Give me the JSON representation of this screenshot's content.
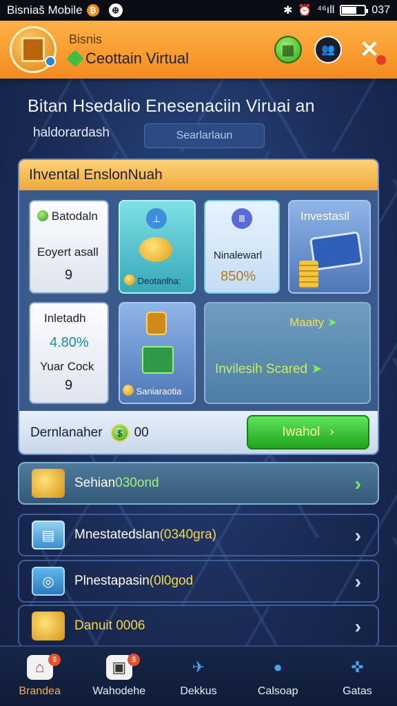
{
  "status_bar": {
    "app_name": "Bisniaš Mobile",
    "time": "037",
    "signal": "⁴⁶ıll"
  },
  "header": {
    "brand_top": "Bisnis",
    "brand_name": "Ceottain Virtual"
  },
  "page": {
    "title": "Bitan Hsedalio Enesenaciin Viruai an",
    "subtitle": "haldorardash",
    "search_placeholder": "Searlarlaun"
  },
  "panel": {
    "title": "Ihvental EnslonNuah",
    "cards": {
      "c1": {
        "title": "Batodaln",
        "label": "Eoyert asall",
        "value": "9"
      },
      "c2": {
        "badge": "Deotanlha:"
      },
      "c3": {
        "label": "Ninalewarl",
        "value": "850%"
      },
      "c4": {
        "title": "Investasil"
      },
      "c5": {
        "title": "Inletadh",
        "value": "4.80%",
        "label": "Yuar Cock",
        "value2": "9"
      },
      "c6": {
        "badge": "Saniaraotia"
      },
      "c7": {
        "line1": "Maaity",
        "line2": "Invilesih Scared"
      }
    },
    "footer": {
      "label": "Dernlanaher",
      "amount": "00",
      "button": "Iwahol"
    }
  },
  "list": [
    {
      "label_white": "Sehian ",
      "label_accent": "030ond",
      "accent": "green"
    },
    {
      "label_white": "Mnestatedslan ",
      "label_accent": "(0340gra)",
      "accent": "yellow"
    },
    {
      "label_white": "Plnestapasin ",
      "label_accent": "(0l0god",
      "accent": "yellow"
    },
    {
      "label_white": "",
      "label_accent": "Danuit 0006",
      "accent": "yellow"
    }
  ],
  "nav": [
    {
      "label": "Brandea",
      "active": true
    },
    {
      "label": "Wahodehe",
      "active": false
    },
    {
      "label": "Dekkus",
      "active": false
    },
    {
      "label": "Calsoap",
      "active": false
    },
    {
      "label": "Gatas",
      "active": false
    }
  ],
  "colors": {
    "header_orange": "#f38b20",
    "accent_green": "#21a21e",
    "accent_yellow": "#f5d94b",
    "background_navy": "#1c2d55"
  }
}
